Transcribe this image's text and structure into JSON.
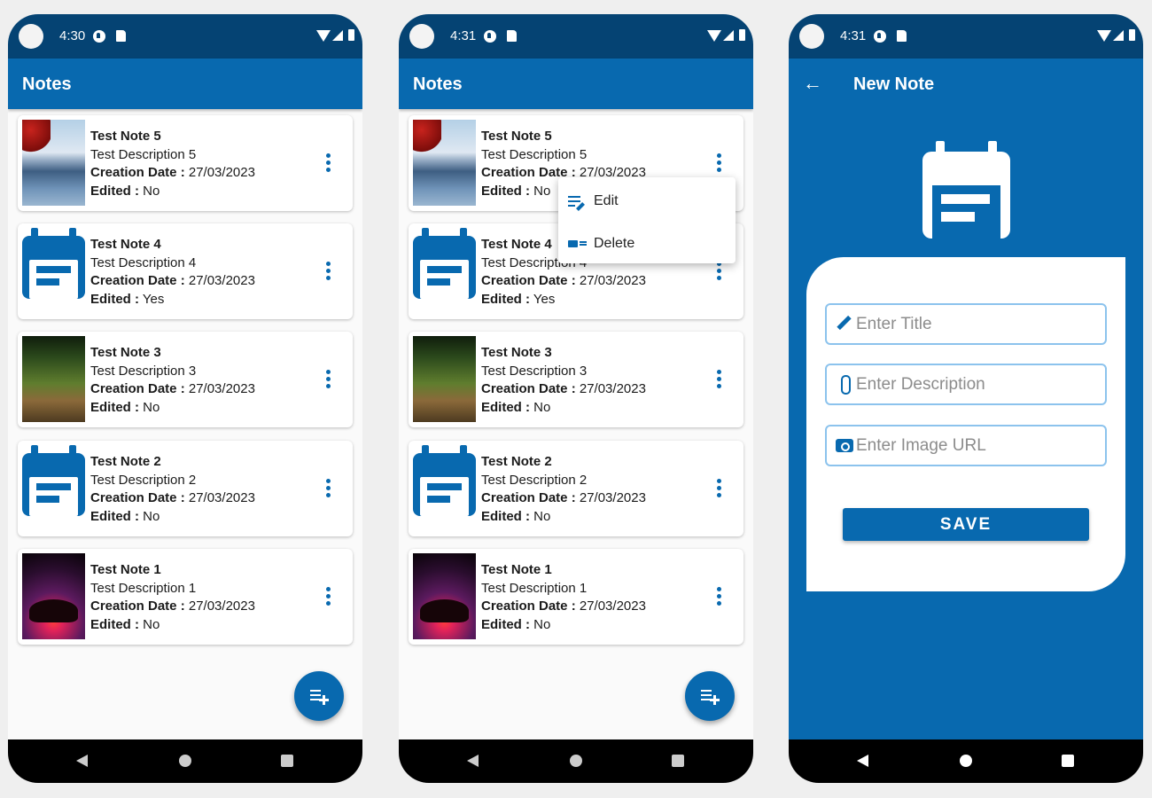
{
  "phones": [
    {
      "time": "4:30",
      "title": "Notes"
    },
    {
      "time": "4:31",
      "title": "Notes"
    },
    {
      "time": "4:31",
      "title": "New Note"
    }
  ],
  "labels": {
    "creation": "Creation Date :",
    "edited": "Edited :"
  },
  "notes": [
    {
      "title": "Test Note 5",
      "description": "Test Description 5",
      "date": "27/03/2023",
      "edited": "No",
      "image": "mountain-lake-photo"
    },
    {
      "title": "Test Note 4",
      "description": "Test Description 4",
      "date": "27/03/2023",
      "edited": "Yes",
      "image": "calendar-icon"
    },
    {
      "title": "Test Note 3",
      "description": "Test Description 3",
      "date": "27/03/2023",
      "edited": "No",
      "image": "forest-path-photo"
    },
    {
      "title": "Test Note 2",
      "description": "Test Description 2",
      "date": "27/03/2023",
      "edited": "No",
      "image": "calendar-icon"
    },
    {
      "title": "Test Note 1",
      "description": "Test Description 1",
      "date": "27/03/2023",
      "edited": "No",
      "image": "sunset-tree-photo"
    }
  ],
  "menu": {
    "edit": "Edit",
    "delete": "Delete"
  },
  "form": {
    "title_placeholder": "Enter Title",
    "description_placeholder": "Enter Description",
    "image_placeholder": "Enter Image URL",
    "save_label": "SAVE"
  },
  "colors": {
    "primary": "#0869af",
    "status_bar": "#054373",
    "field_border": "#8cc3ed"
  }
}
